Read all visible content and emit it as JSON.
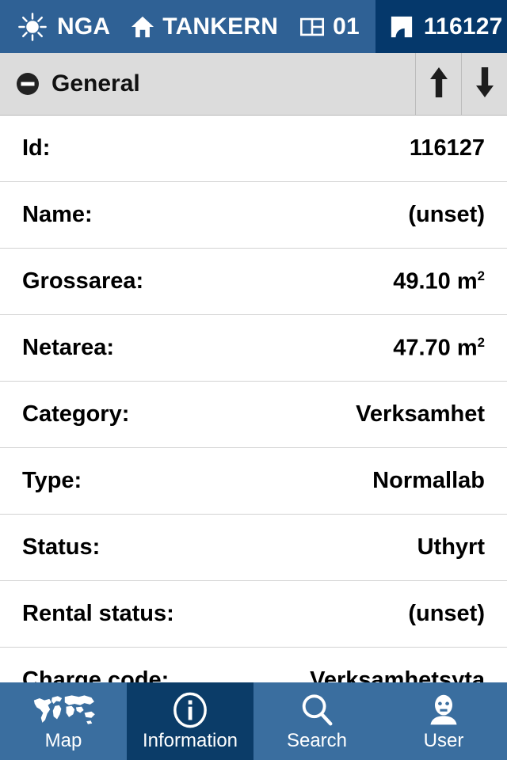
{
  "header": {
    "crumbs": [
      {
        "icon": "sun-icon",
        "label": "NGA"
      },
      {
        "icon": "home-icon",
        "label": "TANKERN"
      },
      {
        "icon": "floorplan-icon",
        "label": "01"
      },
      {
        "icon": "room-icon",
        "label": "116127"
      }
    ],
    "colors": {
      "background": "#2f6195",
      "active_crumb": "#05386b",
      "text": "#ffffff"
    }
  },
  "section": {
    "title": "General",
    "collapse_icon": "minus-circle-icon",
    "up_icon": "arrow-up-icon",
    "down_icon": "arrow-down-icon",
    "background": "#dcdcdc"
  },
  "details": {
    "rows": [
      {
        "label": "Id:",
        "value": "116127",
        "unit": ""
      },
      {
        "label": "Name:",
        "value": "(unset)",
        "unit": ""
      },
      {
        "label": "Grossarea:",
        "value": "49.10 m",
        "unit": "2"
      },
      {
        "label": "Netarea:",
        "value": "47.70 m",
        "unit": "2"
      },
      {
        "label": "Category:",
        "value": "Verksamhet",
        "unit": ""
      },
      {
        "label": "Type:",
        "value": "Normallab",
        "unit": ""
      },
      {
        "label": "Status:",
        "value": "Uthyrt",
        "unit": ""
      },
      {
        "label": "Rental status:",
        "value": "(unset)",
        "unit": ""
      },
      {
        "label": "Charge code:",
        "value": "Verksamhetsyta",
        "unit": ""
      }
    ]
  },
  "tabs": {
    "items": [
      {
        "label": "Map",
        "icon": "world-map-icon",
        "active": false
      },
      {
        "label": "Information",
        "icon": "info-circle-icon",
        "active": true
      },
      {
        "label": "Search",
        "icon": "magnifier-icon",
        "active": false
      },
      {
        "label": "User",
        "icon": "user-person-icon",
        "active": false
      }
    ],
    "colors": {
      "background": "#3a6e9f",
      "active_background": "#0b3c68",
      "text": "#ffffff"
    }
  }
}
